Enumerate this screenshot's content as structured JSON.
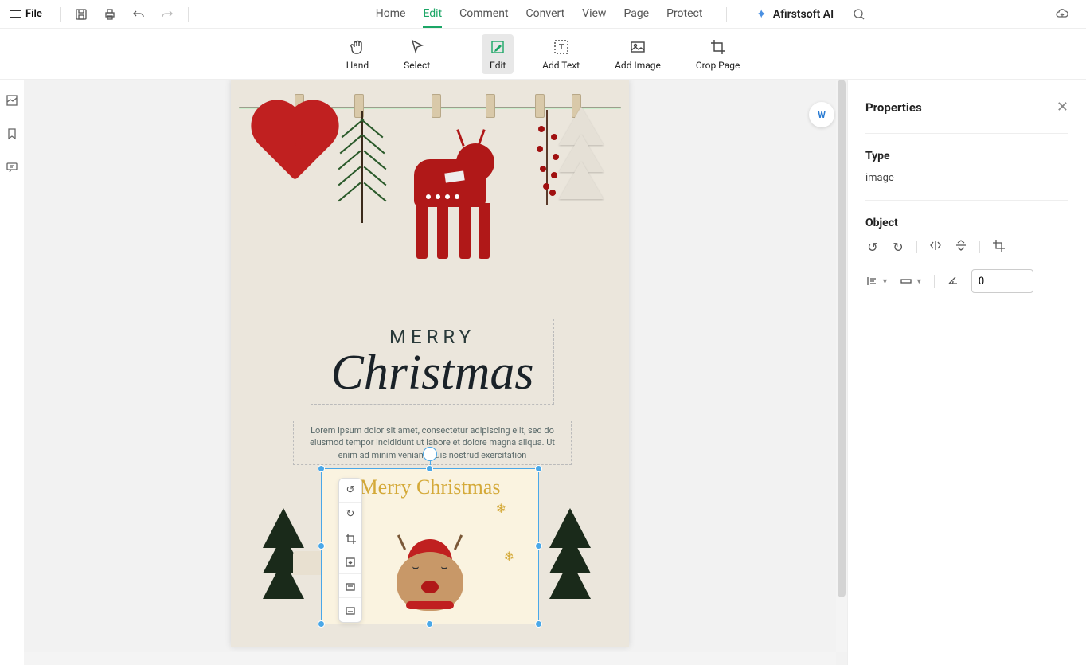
{
  "topbar": {
    "file": "File"
  },
  "nav": {
    "home": "Home",
    "edit": "Edit",
    "comment": "Comment",
    "convert": "Convert",
    "view": "View",
    "page": "Page",
    "protect": "Protect",
    "active": "edit"
  },
  "ai": {
    "label": "Afirstsoft AI"
  },
  "tools": {
    "hand": "Hand",
    "select": "Select",
    "edit": "Edit",
    "addText": "Add Text",
    "addImage": "Add Image",
    "cropPage": "Crop Page",
    "active": "edit"
  },
  "document": {
    "merry": "MERRY",
    "christmas": "Christmas",
    "lorem": "Lorem ipsum dolor sit amet, consectetur adipiscing elit, sed do eiusmod tempor incididunt ut labore et dolore magna aliqua. Ut enim ad minim veniam, quis nostrud exercitation",
    "selectedText": "Merry Christmas"
  },
  "properties": {
    "title": "Properties",
    "typeLabel": "Type",
    "typeValue": "image",
    "objectLabel": "Object",
    "rotation": "0"
  },
  "colors": {
    "accent": "#1ba666",
    "selection": "#4aa8e8",
    "christmasRed": "#b01818"
  }
}
